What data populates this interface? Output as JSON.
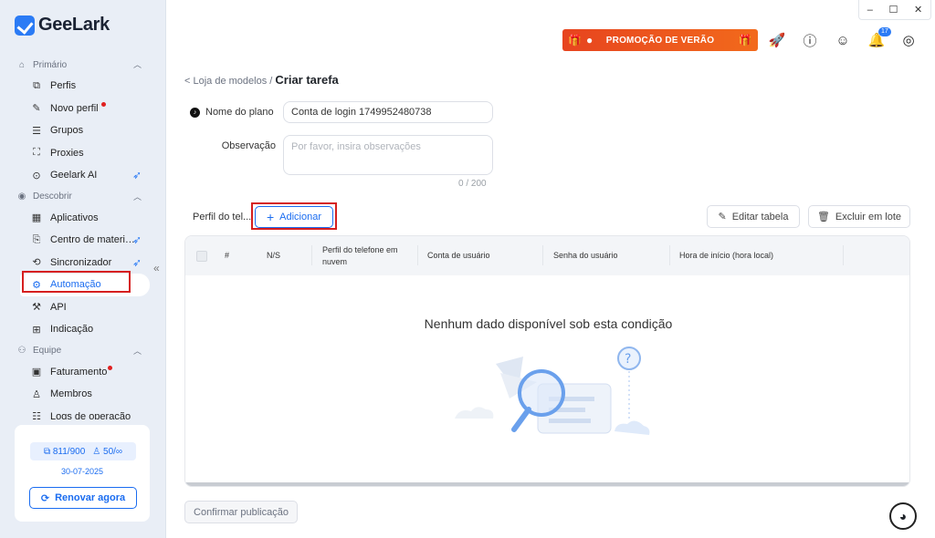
{
  "app": {
    "name": "GeeLark"
  },
  "colors": {
    "accent": "#1a6cf0",
    "promo": "#e7441f",
    "highlight": "#d61f1f",
    "alert_dot": "#e02020"
  },
  "window": {
    "minimize": "–",
    "maximize": "☐",
    "close": "✕"
  },
  "sidebar": {
    "sections": [
      {
        "label": "Primário",
        "icon": "home-icon",
        "items": [
          {
            "label": "Perfis",
            "icon": "profiles-icon"
          },
          {
            "label": "Novo perfil",
            "icon": "edit-icon",
            "dot": true
          },
          {
            "label": "Grupos",
            "icon": "list-icon"
          },
          {
            "label": "Proxies",
            "icon": "network-icon"
          },
          {
            "label": "Geelark AI",
            "icon": "ai-icon",
            "bird": true
          }
        ]
      },
      {
        "label": "Descobrir",
        "icon": "eye-icon",
        "items": [
          {
            "label": "Aplicativos",
            "icon": "apps-icon"
          },
          {
            "label": "Centro de materi…",
            "icon": "materials-icon",
            "bird": true
          },
          {
            "label": "Sincronizador",
            "icon": "sync-icon",
            "bird": true
          },
          {
            "label": "Automação",
            "icon": "robot-icon",
            "active": true
          },
          {
            "label": "API",
            "icon": "api-icon"
          },
          {
            "label": "Indicação",
            "icon": "gift-icon"
          }
        ]
      },
      {
        "label": "Equipe",
        "icon": "team-icon",
        "items": [
          {
            "label": "Faturamento",
            "icon": "billing-icon",
            "dot": true
          },
          {
            "label": "Membros",
            "icon": "member-icon"
          },
          {
            "label": "Logs de operação",
            "icon": "logs-icon"
          }
        ]
      }
    ],
    "quota": {
      "profiles": "811/900",
      "members": "50/∞"
    },
    "expiry_date": "30-07-2025",
    "renew_label": "Renovar agora"
  },
  "topbar": {
    "promo_label": "PROMOÇÃO DE VERÃO",
    "notification_count": "17"
  },
  "breadcrumb": {
    "parent": "< Loja de modelos",
    "sep": "/",
    "current": "Criar tarefa"
  },
  "form": {
    "plan_name_label": "Nome do plano",
    "plan_name_value": "Conta de login 1749952480738",
    "note_label": "Observação",
    "note_placeholder": "Por favor, insira observações",
    "note_counter": "0 / 200",
    "profile_label": "Perfil do tel...",
    "add_label": "Adicionar",
    "edit_table_label": "Editar tabela",
    "bulk_delete_label": "Excluir em lote"
  },
  "table": {
    "columns": [
      "#",
      "N/S",
      "Perfil do telefone em nuvem",
      "Conta de usuário",
      "Senha do usuário",
      "Hora de início (hora local)"
    ],
    "empty_text": "Nenhum dado disponível sob esta condição"
  },
  "footer": {
    "confirm_label": "Confirmar publicação"
  }
}
